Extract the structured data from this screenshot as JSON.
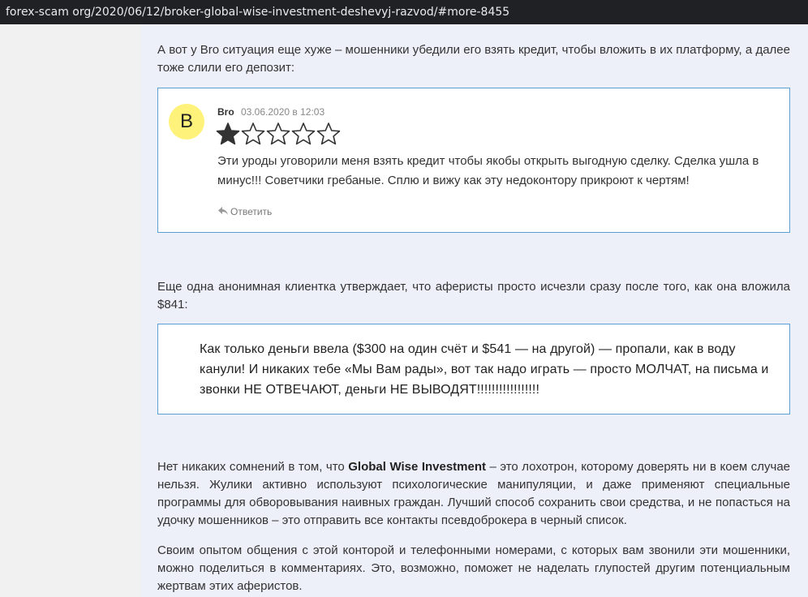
{
  "browser": {
    "url": "forex-scam org/2020/06/12/broker-global-wise-investment-deshevyj-razvod/#more-8455"
  },
  "article": {
    "intro": "А вот у Bro ситуация еще хуже – мошенники убедили его взять кредит, чтобы вложить в их платформу, а далее тоже слили его депозит:",
    "comment": {
      "avatar_letter": "B",
      "author": "Bro",
      "date": "03.06.2020 в 12:03",
      "rating": 1,
      "rating_max": 5,
      "text": "Эти уроды уговорили меня взять кредит чтобы якобы открыть выгодную сделку. Сделка ушла в минус!!! Советчики гребаные. Сплю и вижу как эту недоконтору прикроют к чертям!",
      "reply_label": "Ответить"
    },
    "second_intro": "Еще одна анонимная клиентка утверждает, что аферисты просто исчезли сразу после того, как она вложила $841:",
    "quote": "Как только деньги ввела ($300 на один счёт и $541 — на другой) — пропали, как в воду канули! И никаких тебе «Мы Вам рады», вот так надо играть — просто МОЛЧАТ, на письма и звонки НЕ ОТВЕЧАЮТ, деньги НЕ ВЫВОДЯТ!!!!!!!!!!!!!!!!!",
    "conclusion_prefix": "Нет никаких сомнений в том, что ",
    "conclusion_brand": "Global Wise Investment",
    "conclusion_rest": " – это лохотрон, которому доверять ни в коем случае нельзя. Жулики активно используют психологические манипуляции, и даже применяют специальные программы для обворовывания наивных граждан. Лучший способ сохранить свои средства, и не попасться на удочку мошенников –  это отправить все контакты псевдоброкера в черный список.",
    "final": "Своим опытом общения с этой конторой и телефонными номерами, с которых вам звонили эти мошенники, можно поделиться в комментариях. Это, возможно, поможет не наделать глупостей другим потенциальным жертвам этих аферистов."
  },
  "colors": {
    "star_filled": "#333333",
    "star_empty": "#333333",
    "box_border": "#5a9fd4",
    "avatar_bg": "#fff27a"
  }
}
